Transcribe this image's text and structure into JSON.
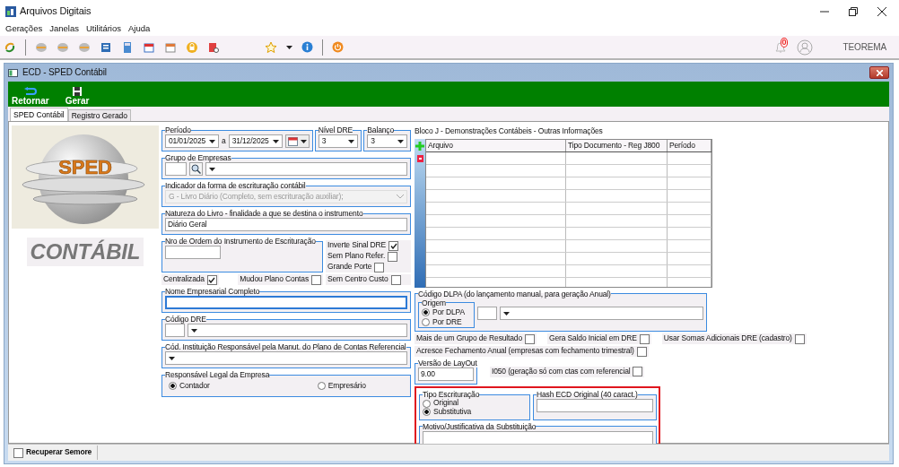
{
  "window": {
    "title": "Arquivos Digitais"
  },
  "menu": [
    "Gerações",
    "Janelas",
    "Utilitários",
    "Ajuda"
  ],
  "toolbar": {
    "notification_count": "0",
    "user": "TEOREMA"
  },
  "child_window": {
    "title": "ECD - SPED Contábil"
  },
  "actions": [
    {
      "kind": "back",
      "label": "Retornar"
    },
    {
      "kind": "save",
      "label": "Gerar"
    }
  ],
  "tabs": [
    {
      "label": "SPED Contábil",
      "selected": true
    },
    {
      "label": "Registro Gerado",
      "selected": false
    }
  ],
  "logo": {
    "badge": "SPED",
    "caption": "CONTÁBIL"
  },
  "periodo": {
    "legend": "Período",
    "start": "01/01/2025",
    "connector": "a",
    "end": "31/12/2025"
  },
  "nivel_dre": {
    "legend": "Nível DRE",
    "value": "3"
  },
  "balanco": {
    "legend": "Balanço",
    "value": "3"
  },
  "grupo_empresas": {
    "legend": "Grupo de Empresas"
  },
  "indicador": {
    "legend": "Indicador da forma de escrituração contábil",
    "value": "G - Livro Diário (Completo, sem escrituração auxiliar);",
    "disabled": true
  },
  "natureza": {
    "legend": "Natureza do Livro - finalidade a que se destina o instrumento",
    "value": "Diário Geral"
  },
  "nro_ordem": {
    "legend": "Nro de Ordem do Instrumento de Escrituração"
  },
  "side_flags": [
    {
      "label": "Inverte Sinal DRE",
      "checked": true
    },
    {
      "label": "Sem Plano Refer.",
      "checked": false
    },
    {
      "label": "Grande Porte",
      "checked": false
    }
  ],
  "row_flags": [
    {
      "label": "Centralizada",
      "checked": true
    },
    {
      "label": "Mudou Plano Contas",
      "checked": false
    },
    {
      "label": "Sem Centro Custo",
      "checked": false
    }
  ],
  "nome_empresarial": {
    "legend": "Nome Empresarial Completo",
    "focused": true
  },
  "codigo_dre": {
    "legend": "Código DRE"
  },
  "cod_instituicao": {
    "legend": "Cód. Instituição Responsável pela Manut. do Plano de Contas Referencial"
  },
  "responsavel": {
    "legend": "Responsável Legal da Empresa",
    "options": [
      {
        "label": "Contador",
        "selected": true
      },
      {
        "label": "Empresário",
        "selected": false
      }
    ]
  },
  "bloco_j": {
    "title": "Bloco J - Demonstrações Contábeis - Outras Informações",
    "columns": [
      "Arquivo",
      "Tipo Documento - Reg J800",
      "Período"
    ]
  },
  "dlpa": {
    "legend": "Código DLPA (do lançamento manual,  para geração Anual)",
    "origem": {
      "legend": "Origem",
      "options": [
        {
          "label": "Por DLPA",
          "selected": true
        },
        {
          "label": "Por DRE",
          "selected": false
        }
      ]
    }
  },
  "options": [
    {
      "label": "Mais de um Grupo de Resultado",
      "checked": false
    },
    {
      "label": "Gera Saldo Inicial em DRE",
      "checked": false
    },
    {
      "label": "Usar Somas Adicionais DRE (cadastro)",
      "checked": false
    },
    {
      "label": "Acresce Fechamento Anual (empresas com fechamento trimestral)",
      "checked": false
    }
  ],
  "versao": {
    "legend": "Versão de LayOut",
    "value": "9.00"
  },
  "i050": {
    "label": "I050 (geração só com ctas com referencial",
    "checked": false
  },
  "tipo_escrituracao": {
    "legend": "Tipo Escrituração",
    "options": [
      {
        "label": "Original",
        "selected": false
      },
      {
        "label": "Substitutiva",
        "selected": true
      }
    ]
  },
  "hash": {
    "legend": "Hash ECD Original (40 caract.)"
  },
  "motivo": {
    "legend": "Motivo/Justificativa da Substituição"
  },
  "status_bar": {
    "label": "Recuperar Semore",
    "checked": false
  }
}
